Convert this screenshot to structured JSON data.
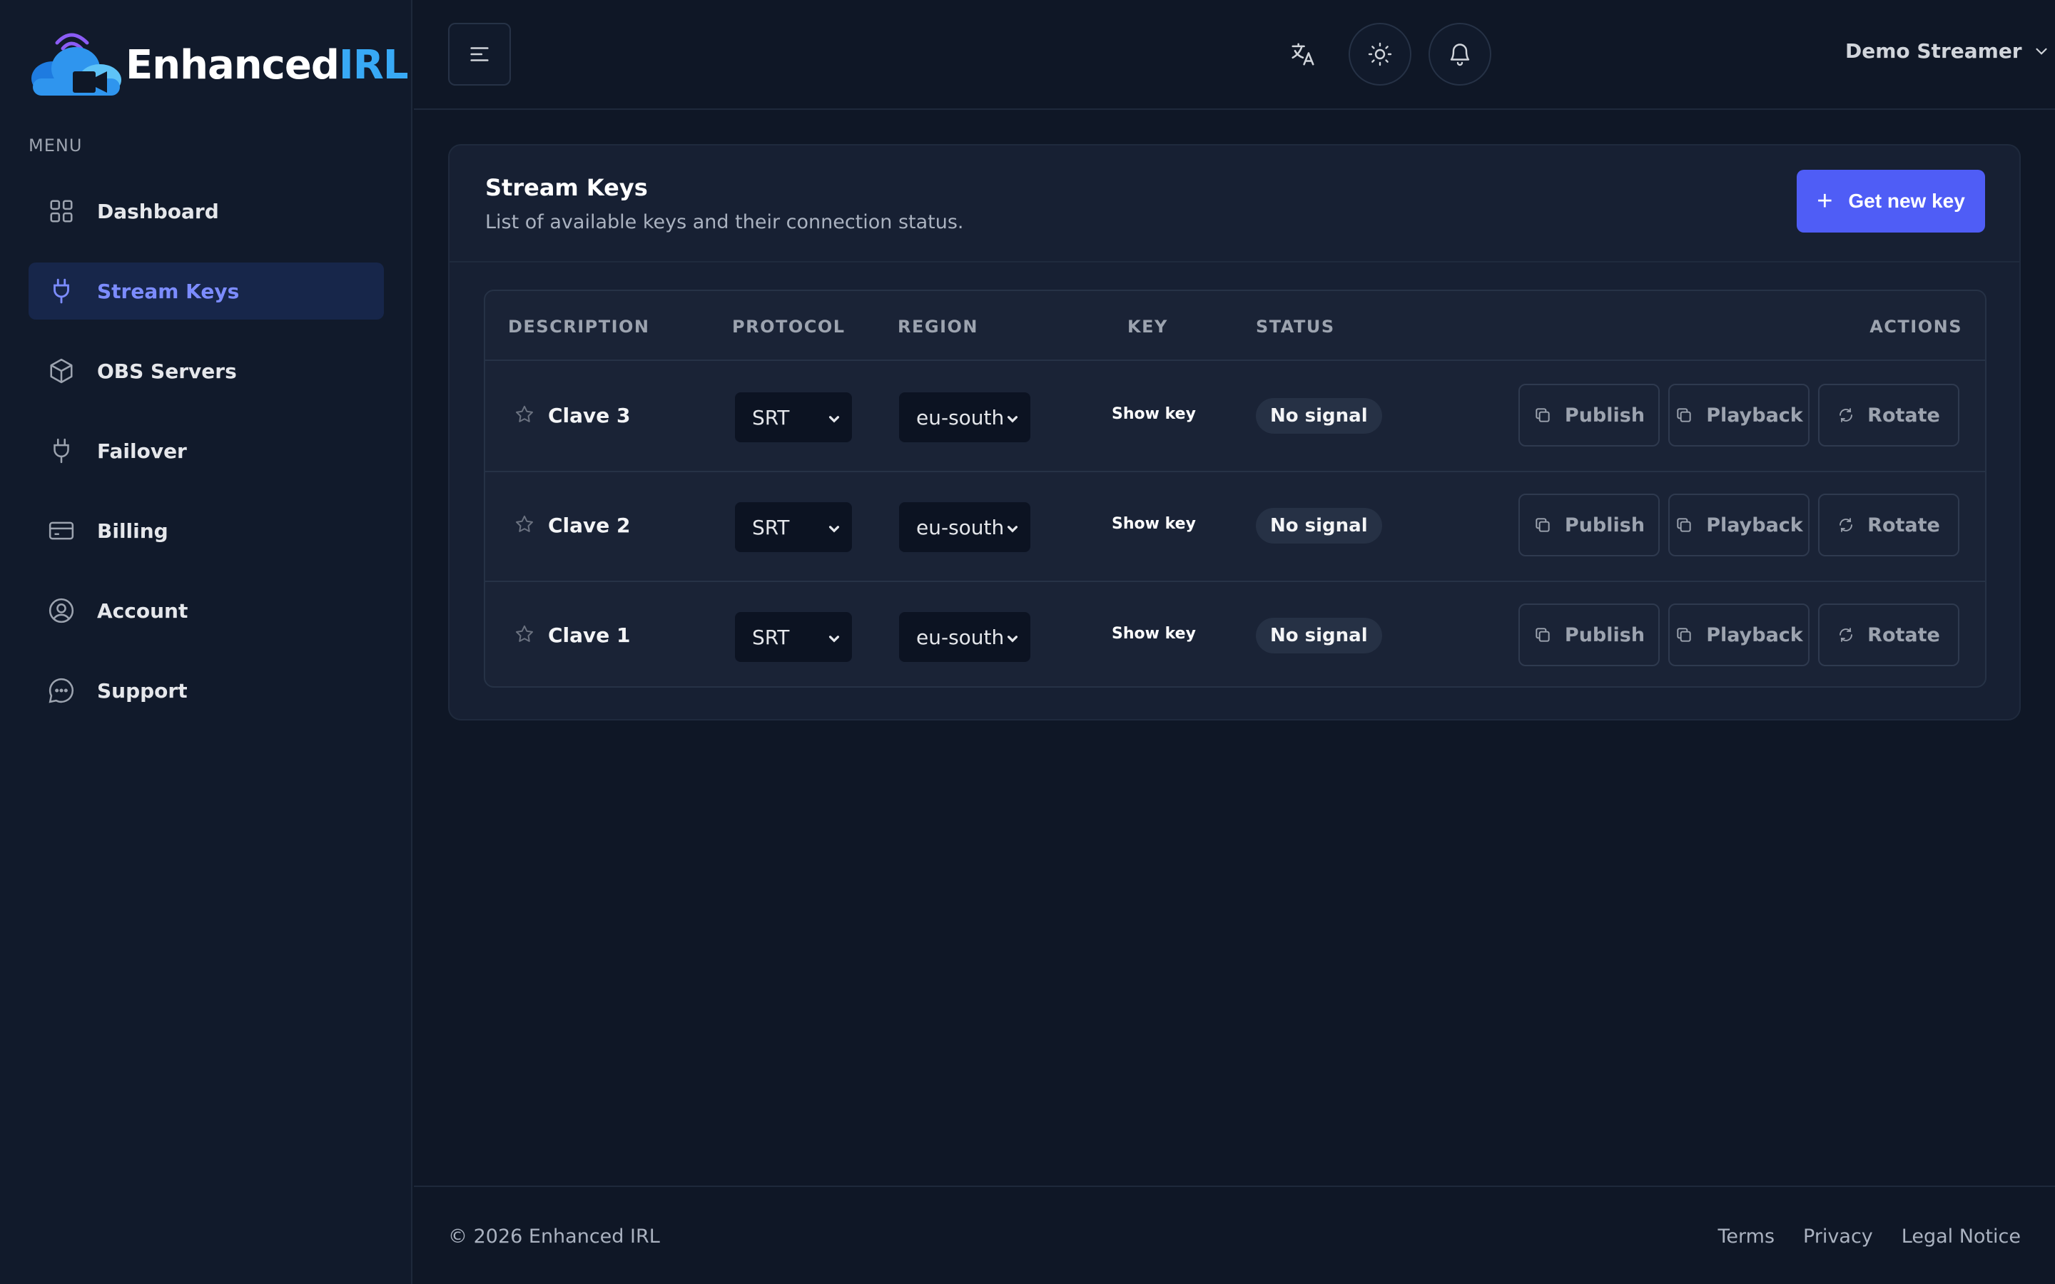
{
  "brand": {
    "name_part1": "Enhanced",
    "name_part2": "IRL"
  },
  "sidebar": {
    "menu_label": "MENU",
    "items": [
      {
        "label": "Dashboard",
        "icon": "grid-icon"
      },
      {
        "label": "Stream Keys",
        "icon": "plug-icon",
        "active": true
      },
      {
        "label": "OBS Servers",
        "icon": "box-icon"
      },
      {
        "label": "Failover",
        "icon": "plug-icon"
      },
      {
        "label": "Billing",
        "icon": "credit-card-icon"
      },
      {
        "label": "Account",
        "icon": "user-circle-icon"
      },
      {
        "label": "Support",
        "icon": "chat-icon"
      }
    ]
  },
  "header": {
    "user_name": "Demo Streamer",
    "icons": [
      "menu-icon",
      "translate-icon",
      "sun-icon",
      "bell-icon"
    ]
  },
  "card": {
    "title": "Stream Keys",
    "subtitle": "List of available keys and their connection status.",
    "new_key_label": "Get new key",
    "columns": [
      "DESCRIPTION",
      "PROTOCOL",
      "REGION",
      "KEY",
      "STATUS",
      "ACTIONS"
    ],
    "rows": [
      {
        "description": "Clave 3",
        "protocol": "SRT",
        "region": "eu-south",
        "key_label": "Show key",
        "status": "No signal"
      },
      {
        "description": "Clave 2",
        "protocol": "SRT",
        "region": "eu-south",
        "key_label": "Show key",
        "status": "No signal"
      },
      {
        "description": "Clave 1",
        "protocol": "SRT",
        "region": "eu-south",
        "key_label": "Show key",
        "status": "No signal"
      }
    ],
    "actions": {
      "publish": "Publish",
      "playback": "Playback",
      "rotate": "Rotate"
    }
  },
  "footer": {
    "copyright": "© 2026 Enhanced IRL",
    "links": [
      "Terms",
      "Privacy",
      "Legal Notice"
    ]
  },
  "colors": {
    "accent": "#4f5df6",
    "active_nav": "#7c8cff",
    "brand_blue": "#38a9f5",
    "background": "#0f1726"
  }
}
